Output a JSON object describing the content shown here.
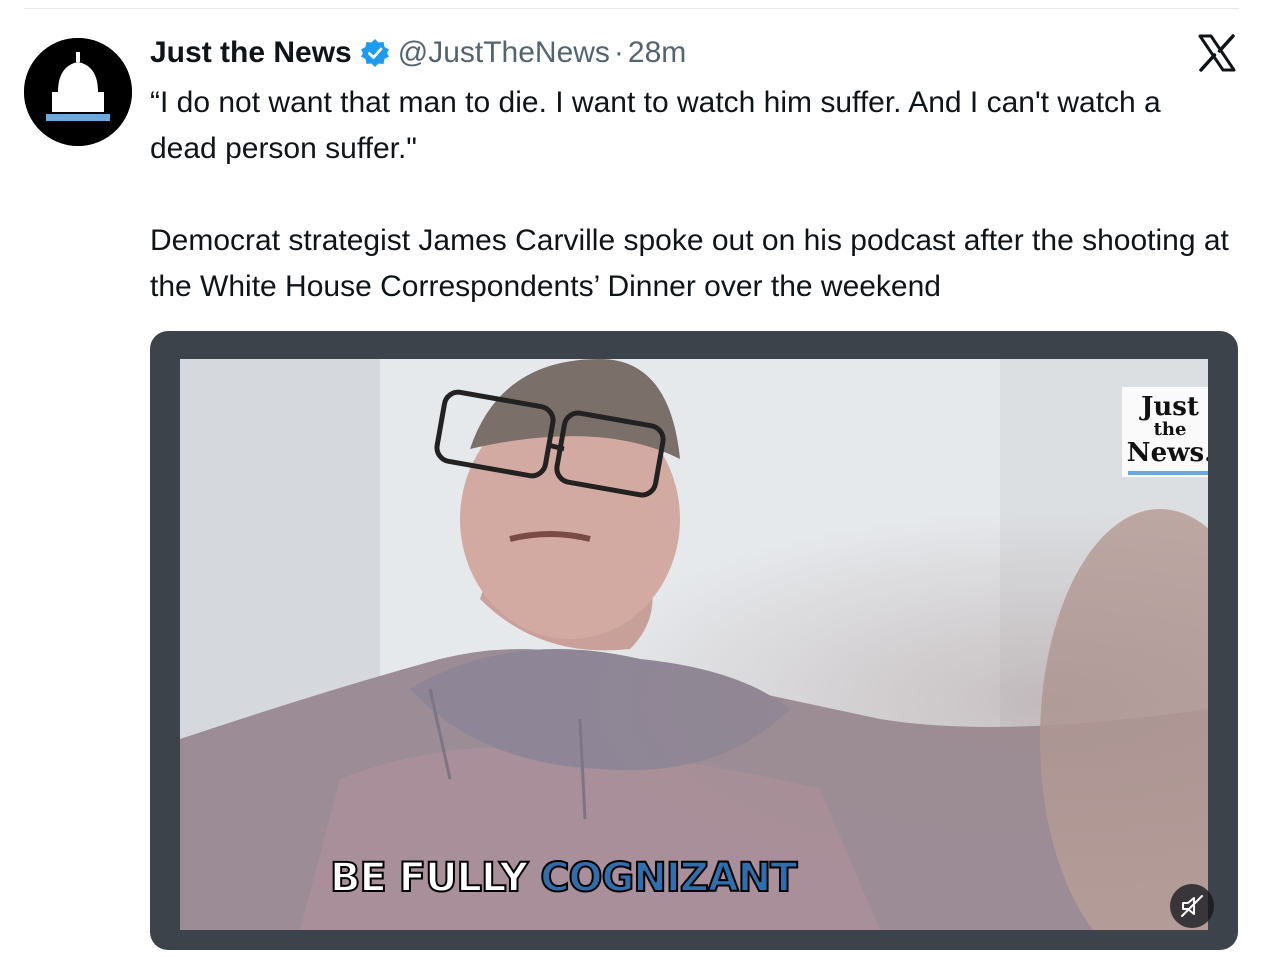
{
  "tweet": {
    "display_name": "Just the News",
    "handle": "@JustTheNews",
    "separator": "·",
    "time": "28m",
    "text_line1": "“I do not want that man to die. I want to watch him suffer. And I can't watch a dead person suffer.\"",
    "text_line2": "Democrat strategist James Carville spoke out on his podcast after the shooting at the White House Correspondents’ Dinner over the weekend"
  },
  "media": {
    "subtitle_part1": "BE FULLY ",
    "subtitle_part2": "COGNIZANT",
    "watermark": {
      "line1": "Just",
      "line2": "the",
      "line3": "News."
    }
  },
  "icons": {
    "avatar": "capitol-dome-logo",
    "verified": "verified-badge-icon",
    "platform": "x-logo-icon",
    "mute": "muted-speaker-icon"
  },
  "colors": {
    "verified_blue": "#1d9bf0",
    "secondary_text": "#536471",
    "subtitle_blue": "#2f6fae",
    "logo_accent": "#6aa9df"
  }
}
